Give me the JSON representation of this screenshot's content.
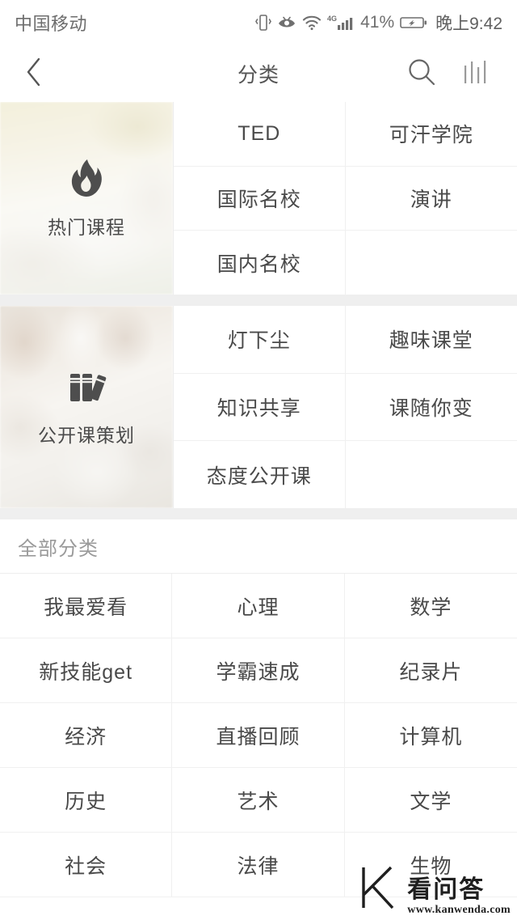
{
  "statusbar": {
    "carrier": "中国移动",
    "icons": [
      "vibrate-icon",
      "eye-icon",
      "wifi-icon",
      "signal-4g-icon",
      "battery-icon"
    ],
    "network_label": "4G",
    "battery_percent": "41%",
    "time": "晚上9:42"
  },
  "navbar": {
    "back_icon": "chevron-left-icon",
    "title": "分类",
    "search_icon": "search-icon",
    "equalizer_icon": "equalizer-icon"
  },
  "features": [
    {
      "label": "热门课程",
      "icon": "flame-icon",
      "items": [
        "TED",
        "可汗学院",
        "国际名校",
        "演讲",
        "国内名校",
        ""
      ]
    },
    {
      "label": "公开课策划",
      "icon": "books-icon",
      "items": [
        "灯下尘",
        "趣味课堂",
        "知识共享",
        "课随你变",
        "态度公开课",
        ""
      ]
    }
  ],
  "all_categories": {
    "title": "全部分类",
    "items": [
      "我最爱看",
      "心理",
      "数学",
      "新技能get",
      "学霸速成",
      "纪录片",
      "经济",
      "直播回顾",
      "计算机",
      "历史",
      "艺术",
      "文学",
      "社会",
      "法律",
      "生物"
    ]
  },
  "watermark": {
    "logo_icon": "k-logo-icon",
    "name": "看问答",
    "url": "www.kanwenda.com"
  },
  "colors": {
    "text_primary": "#4a4a4a",
    "text_muted": "#9a9a9a",
    "divider": "#f0f0f0",
    "band": "#efefef",
    "background": "#ffffff"
  }
}
